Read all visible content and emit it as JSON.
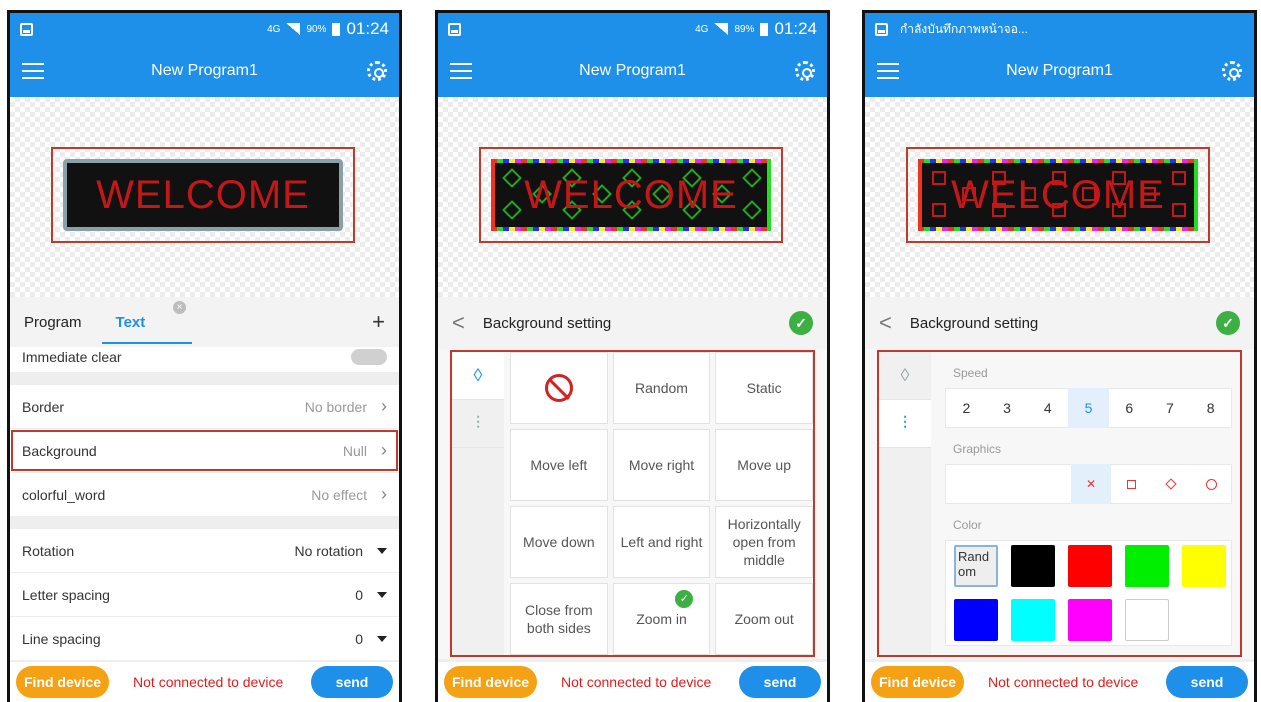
{
  "colors": {
    "primary": "#1e90ea",
    "highlight_frame": "#c0392b",
    "led_text": "#c41818",
    "find_button": "#f5a114",
    "status_red": "#e41b1b",
    "check_green": "#3cb043"
  },
  "screen1": {
    "status": {
      "network": "4G",
      "battery": "90%",
      "time": "01:24"
    },
    "appbar": {
      "title": "New Program1"
    },
    "preview": {
      "led_text": "WELCOME"
    },
    "tabs": {
      "program": "Program",
      "text": "Text",
      "plus": "+"
    },
    "rows": {
      "immediate_clear": {
        "label": "Immediate clear"
      },
      "border": {
        "label": "Border",
        "value": "No border"
      },
      "background": {
        "label": "Background",
        "value": "Null"
      },
      "colorful_word": {
        "label": "colorful_word",
        "value": "No effect"
      },
      "rotation": {
        "label": "Rotation",
        "value": "No rotation"
      },
      "letter_spacing": {
        "label": "Letter spacing",
        "value": "0"
      },
      "line_spacing": {
        "label": "Line spacing",
        "value": "0"
      }
    },
    "bottom": {
      "find": "Find device",
      "status": "Not connected to device",
      "send": "send"
    }
  },
  "screen2": {
    "status": {
      "network": "4G",
      "battery": "89%",
      "time": "01:24"
    },
    "appbar": {
      "title": "New Program1"
    },
    "preview": {
      "led_text": "WELCOME"
    },
    "header": {
      "title": "Background setting",
      "back": "<"
    },
    "effects": {
      "none_icon": "no-entry-icon",
      "random": "Random",
      "static": "Static",
      "move_left": "Move left",
      "move_right": "Move right",
      "move_up": "Move up",
      "move_down": "Move down",
      "left_and_right": "Left and right",
      "horizontally_open": "Horizontally open from middle",
      "close_both": "Close from both sides",
      "zoom_in": "Zoom in",
      "zoom_out": "Zoom out",
      "selected": "Zoom in"
    },
    "bottom": {
      "find": "Find device",
      "status": "Not connected to device",
      "send": "send"
    }
  },
  "screen3": {
    "status": {
      "notice": "กำลังบันทึกภาพหน้าจอ..."
    },
    "appbar": {
      "title": "New Program1"
    },
    "preview": {
      "led_text": "WELCOME"
    },
    "header": {
      "title": "Background setting",
      "back": "<"
    },
    "speed": {
      "label": "Speed",
      "options": [
        "2",
        "3",
        "4",
        "5",
        "6",
        "7",
        "8"
      ],
      "selected": "5"
    },
    "graphics": {
      "label": "Graphics",
      "selected": "cross-icon",
      "options": [
        "cross-icon",
        "square-icon",
        "diamond-icon",
        "circle-icon"
      ]
    },
    "color": {
      "label": "Color",
      "random": "Random",
      "swatches": [
        "#000000",
        "#ff0000",
        "#00ee00",
        "#ffff00",
        "#0000ff",
        "#00ffff",
        "#ff00ff",
        "#ffffff"
      ]
    },
    "bottom": {
      "find": "Find device",
      "status": "Not connected to device",
      "send": "send"
    }
  }
}
